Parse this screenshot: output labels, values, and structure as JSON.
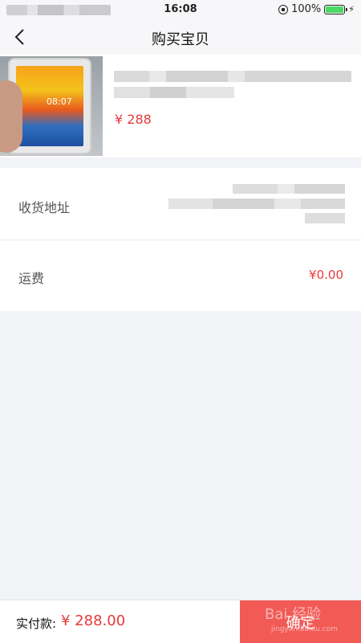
{
  "status_bar": {
    "time": "16:08",
    "battery": "100%",
    "icons": [
      "orientation-lock-icon",
      "battery-icon",
      "charging-bolt-icon"
    ]
  },
  "nav": {
    "title": "购买宝贝",
    "back_icon": "chevron-left-icon"
  },
  "product": {
    "phone_clock": "08:07",
    "price": "¥ 288"
  },
  "details": {
    "address_label": "收货地址",
    "shipping_label": "运费",
    "shipping_value": "¥0.00"
  },
  "footer": {
    "total_label": "实付款:",
    "total_value": "¥ 288.00",
    "confirm_label": "确定",
    "watermark": "Bai 经验",
    "watermark_sub": "jingyan.baidu.com"
  },
  "colors": {
    "accent": "#e83a3a",
    "button": "#f15a55",
    "background": "#f2f3f7"
  }
}
